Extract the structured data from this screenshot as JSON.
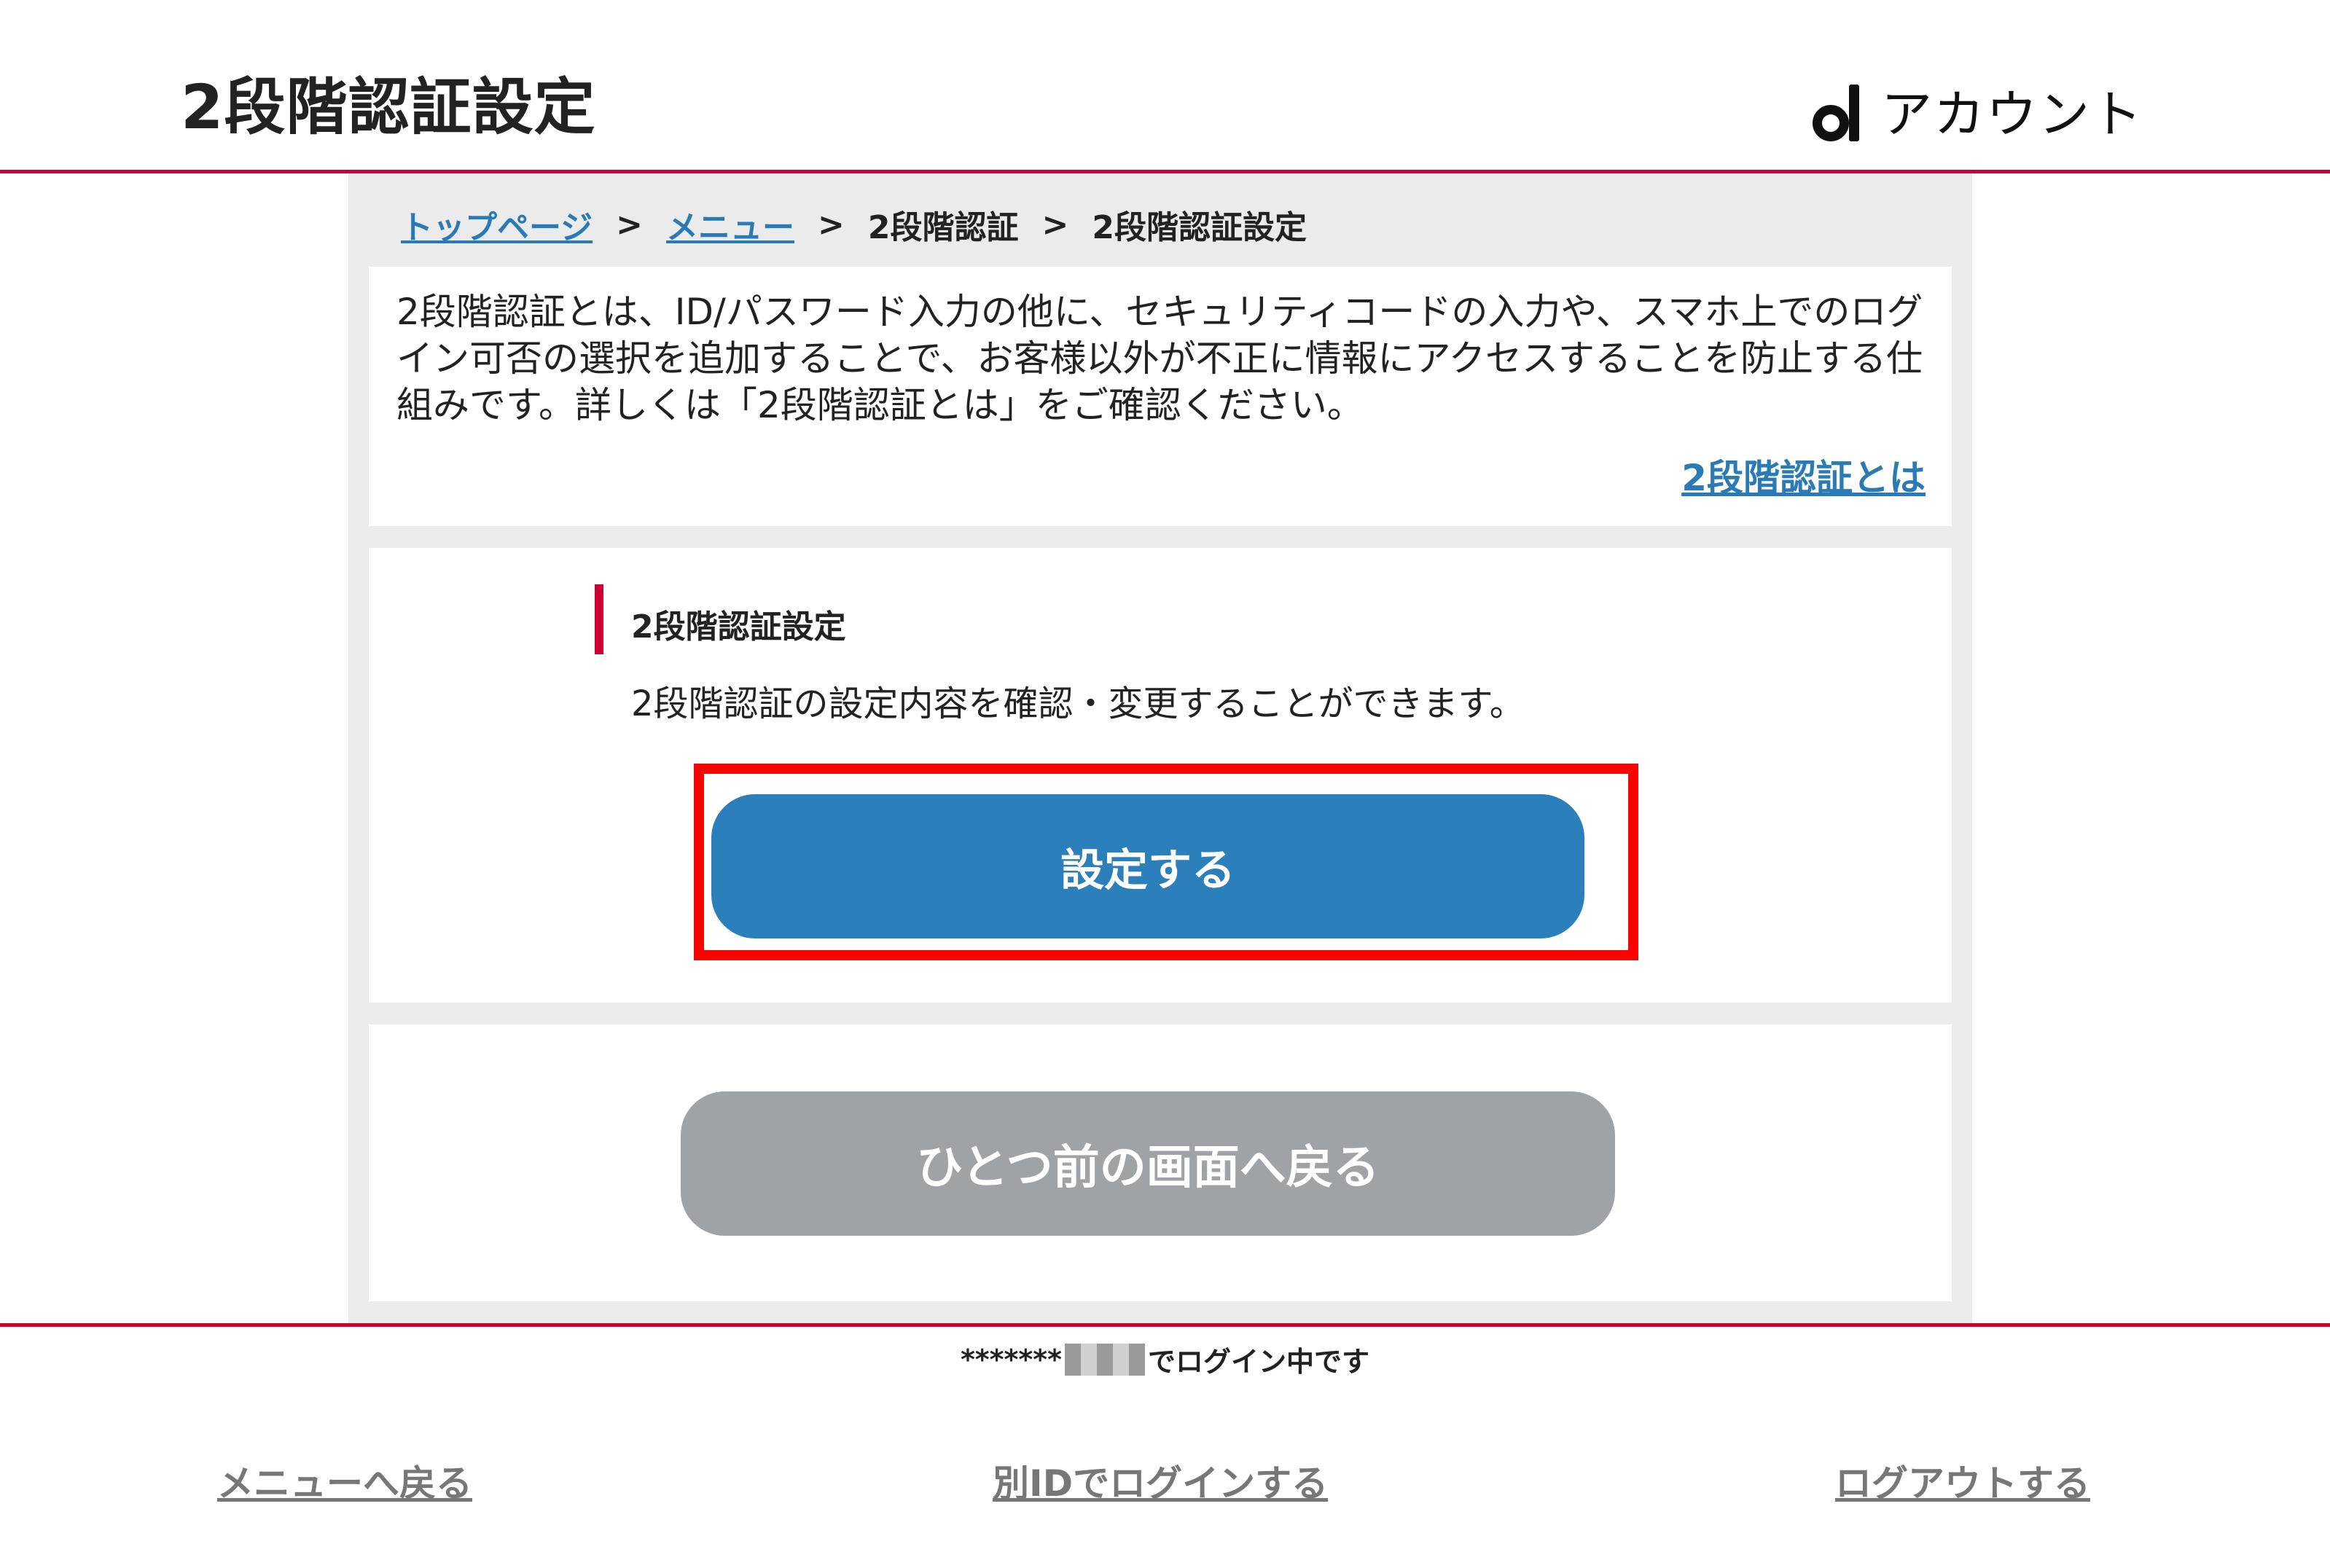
{
  "header": {
    "title": "2段階認証設定",
    "brand_text": "アカウント"
  },
  "breadcrumb": {
    "items": [
      "トップページ",
      "メニュー",
      "2段階認証",
      "2段階認証設定"
    ],
    "separator": ">"
  },
  "info": {
    "text": "2段階認証とは、ID/パスワード入力の他に、セキュリティコードの入力や、スマホ上でのログイン可否の選択を追加することで、お客様以外が不正に情報にアクセスすることを防止する仕組みです。詳しくは「2段階認証とは」をご確認ください。",
    "link": "2段階認証とは"
  },
  "settings": {
    "title": "2段階認証設定",
    "description": "2段階認証の設定内容を確認・変更することができます。",
    "button": "設定する"
  },
  "back": {
    "button": "ひとつ前の画面へ戻る"
  },
  "login_status": {
    "masked_id": "*******",
    "suffix": "でログイン中です"
  },
  "footer": {
    "links": [
      "メニューへ戻る",
      "別IDでログインする",
      "ログアウトする"
    ]
  },
  "colors": {
    "accent_red": "#cc0033",
    "link_blue": "#2a7ab6",
    "primary_button": "#2b7fba",
    "back_button": "#a0a3a6",
    "highlight": "#ff0000"
  }
}
